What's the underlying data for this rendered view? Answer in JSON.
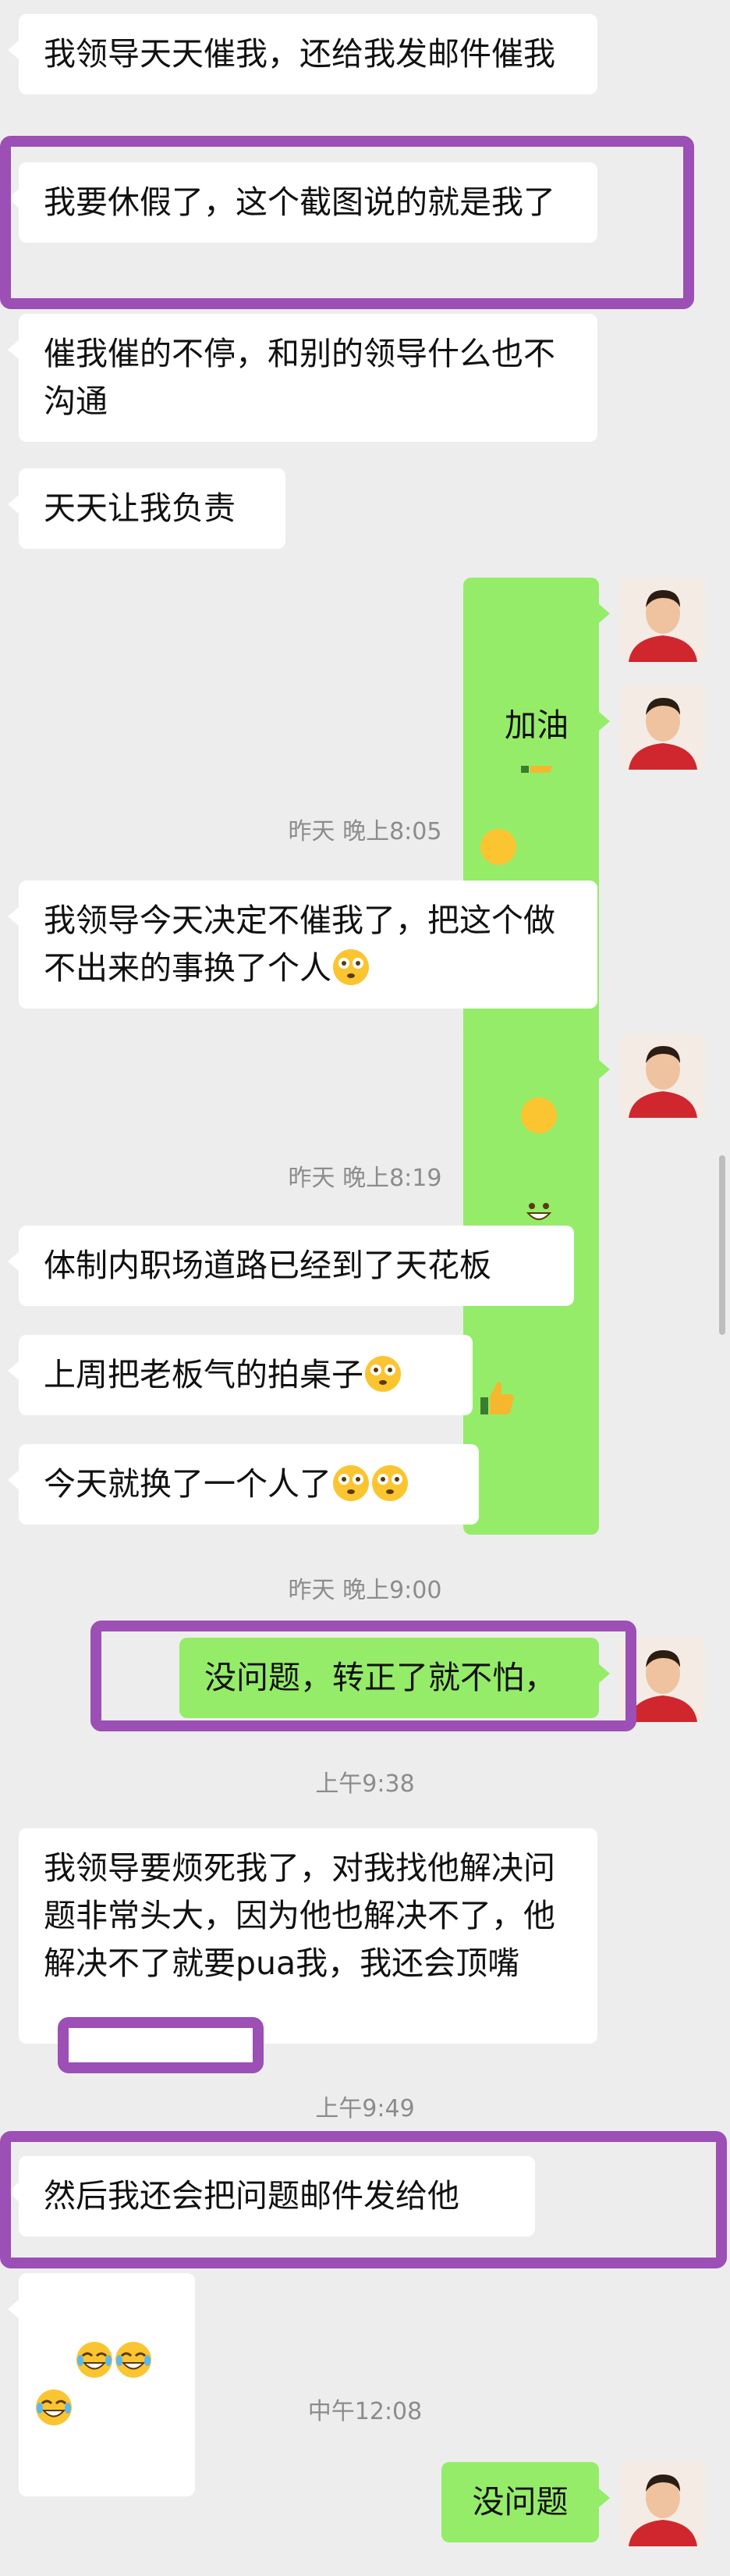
{
  "messages": [
    {
      "text": "我领导天天催我，还给我发邮件催我"
    },
    {
      "text": "我要休假了，这个截图说的就是我了"
    },
    {
      "text": "催我催的不停，和别的领导什么也不沟通"
    },
    {
      "text": "天天让我负责"
    },
    {
      "emoji": [
        "thumbs-up",
        "grin"
      ]
    },
    {
      "text": "加油"
    },
    {
      "time": "昨天 晚上8:05"
    },
    {
      "text": "我领导今天决定不催我了，把这个做不出来的事换了个人",
      "emoji": [
        "flushed"
      ]
    },
    {
      "emoji": [
        "grin",
        "thumbs-up"
      ]
    },
    {
      "time": "昨天 晚上8:19"
    },
    {
      "text": "体制内职场道路已经到了天花板"
    },
    {
      "text": "上周把老板气的拍桌子",
      "emoji": [
        "flushed"
      ]
    },
    {
      "text": "今天就换了一个人了",
      "emoji": [
        "flushed",
        "flushed"
      ]
    },
    {
      "time": "昨天 晚上9:00"
    },
    {
      "text": "没问题，转正了就不怕，"
    },
    {
      "time": "上午9:38"
    },
    {
      "text": "我领导要烦死我了，对我找他解决问题非常头大，因为他也解决不了，他解决不了就要pua我，我还会顶嘴"
    },
    {
      "time": "上午9:49"
    },
    {
      "text": "然后我还会把问题邮件发给他"
    },
    {
      "emoji": [
        "joy",
        "joy",
        "joy"
      ]
    },
    {
      "time": "中午12:08"
    },
    {
      "text": "没问题"
    }
  ],
  "colors": {
    "background": "#ededed",
    "incoming_bubble": "#ffffff",
    "outgoing_bubble": "#95ec69",
    "highlight": "#9c4fb5"
  }
}
